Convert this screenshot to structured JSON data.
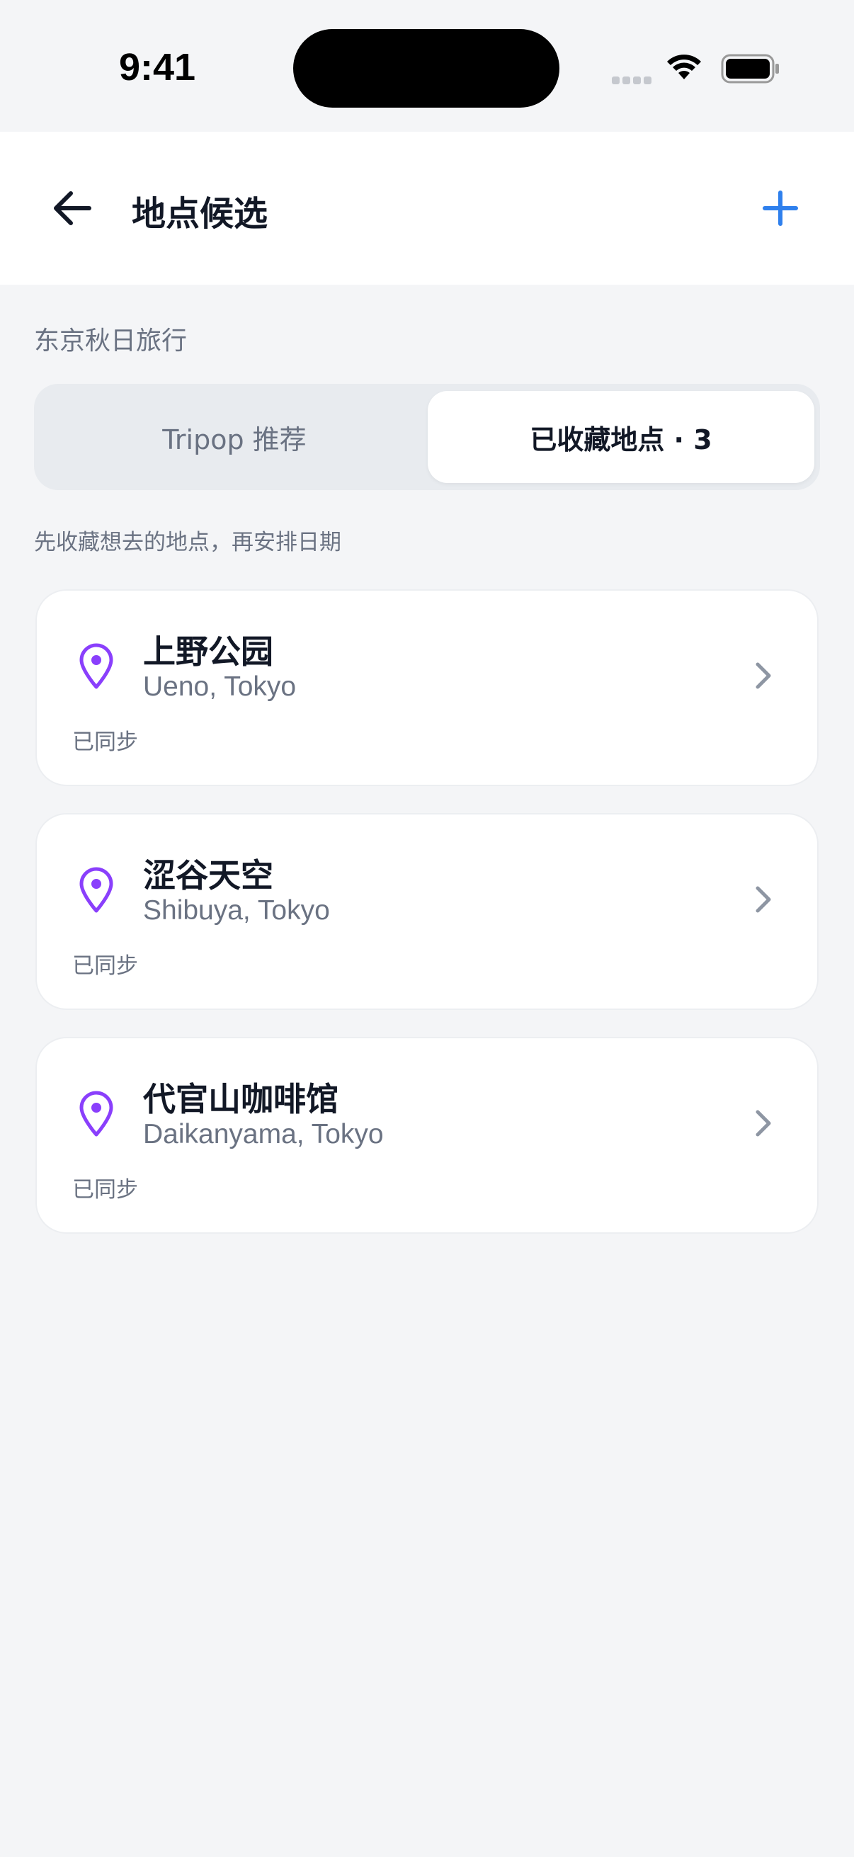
{
  "status": {
    "time": "9:41"
  },
  "nav": {
    "title": "地点候选",
    "back_icon": "arrow-left-icon",
    "add_icon": "plus-icon"
  },
  "trip": {
    "name": "东京秋日旅行"
  },
  "tabs": [
    {
      "label": "Tripop 推荐",
      "selected": false
    },
    {
      "label": "已收藏地点 · 3",
      "selected": true
    }
  ],
  "hint": "先收藏想去的地点，再安排日期",
  "places": [
    {
      "name": "上野公园",
      "location": "Ueno, Tokyo",
      "status": "已同步"
    },
    {
      "name": "涩谷天空",
      "location": "Shibuya, Tokyo",
      "status": "已同步"
    },
    {
      "name": "代官山咖啡馆",
      "location": "Daikanyama, Tokyo",
      "status": "已同步"
    }
  ],
  "colors": {
    "accent": "#2f80ed",
    "pin": "#8a3ffc",
    "background": "#f4f5f7"
  }
}
